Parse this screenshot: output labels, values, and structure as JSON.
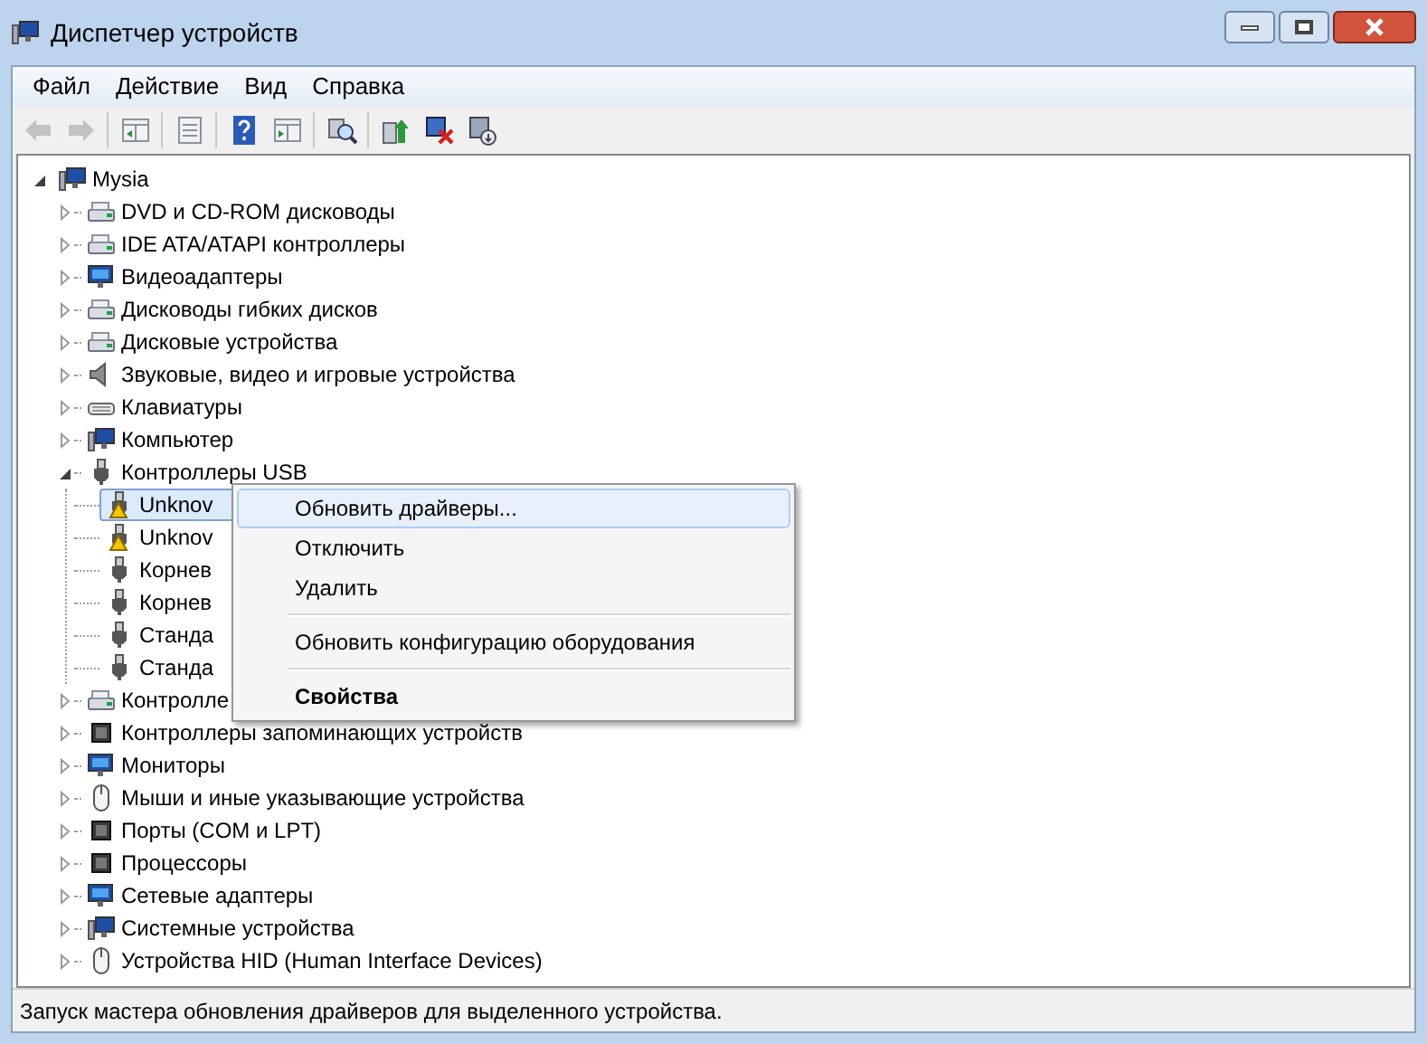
{
  "window": {
    "title": "Диспетчер устройств"
  },
  "menu_bar": [
    {
      "label": "Файл"
    },
    {
      "label": "Действие"
    },
    {
      "label": "Вид"
    },
    {
      "label": "Справка"
    }
  ],
  "toolbar": [
    {
      "kind": "back",
      "disabled": true
    },
    {
      "kind": "forward",
      "disabled": true
    },
    {
      "kind": "separator"
    },
    {
      "kind": "pane",
      "disabled": false
    },
    {
      "kind": "separator"
    },
    {
      "kind": "properties",
      "disabled": false
    },
    {
      "kind": "separator"
    },
    {
      "kind": "help",
      "disabled": false
    },
    {
      "kind": "view",
      "disabled": false
    },
    {
      "kind": "separator"
    },
    {
      "kind": "scan",
      "disabled": false
    },
    {
      "kind": "separator"
    },
    {
      "kind": "update",
      "disabled": false
    },
    {
      "kind": "uninstall",
      "disabled": false
    },
    {
      "kind": "disable",
      "disabled": false
    }
  ],
  "tree": {
    "label": "Mysia",
    "expanded": true,
    "selected": false,
    "children": [
      {
        "label": "DVD и CD-ROM дисководы",
        "expanded": false,
        "selected": false
      },
      {
        "label": "IDE ATA/ATAPI контроллеры",
        "expanded": false,
        "selected": false
      },
      {
        "label": "Видеоадаптеры",
        "expanded": false,
        "selected": false
      },
      {
        "label": "Дисководы гибких дисков",
        "expanded": false,
        "selected": false
      },
      {
        "label": "Дисковые устройства",
        "expanded": false,
        "selected": false
      },
      {
        "label": "Звуковые, видео и игровые устройства",
        "expanded": false,
        "selected": false
      },
      {
        "label": "Клавиатуры",
        "expanded": false,
        "selected": false
      },
      {
        "label": "Компьютер",
        "expanded": false,
        "selected": false
      },
      {
        "label": "Контроллеры USB",
        "expanded": true,
        "selected": false,
        "children": [
          {
            "label": "Unknov",
            "selected": true,
            "warning": true
          },
          {
            "label": "Unknov",
            "selected": false,
            "warning": true
          },
          {
            "label": "Корнев",
            "selected": false,
            "warning": false
          },
          {
            "label": "Корнев",
            "selected": false,
            "warning": false
          },
          {
            "label": "Станда",
            "selected": false,
            "warning": false
          },
          {
            "label": "Станда",
            "selected": false,
            "warning": false
          }
        ]
      },
      {
        "label": "Контролле",
        "expanded": false,
        "selected": false
      },
      {
        "label": "Контроллеры запоминающих устройств",
        "expanded": false,
        "selected": false
      },
      {
        "label": "Мониторы",
        "expanded": false,
        "selected": false
      },
      {
        "label": "Мыши и иные указывающие устройства",
        "expanded": false,
        "selected": false
      },
      {
        "label": "Порты (COM и LPT)",
        "expanded": false,
        "selected": false
      },
      {
        "label": "Процессоры",
        "expanded": false,
        "selected": false
      },
      {
        "label": "Сетевые адаптеры",
        "expanded": false,
        "selected": false
      },
      {
        "label": "Системные устройства",
        "expanded": false,
        "selected": false
      },
      {
        "label": "Устройства HID (Human Interface Devices)",
        "expanded": false,
        "selected": false
      }
    ]
  },
  "context_menu": [
    {
      "label": "Обновить драйверы...",
      "highlighted": true,
      "default": false,
      "separator_before": false
    },
    {
      "label": "Отключить",
      "highlighted": false,
      "default": false,
      "separator_before": false
    },
    {
      "label": "Удалить",
      "highlighted": false,
      "default": false,
      "separator_before": false
    },
    {
      "label": "Обновить конфигурацию оборудования",
      "highlighted": false,
      "default": false,
      "separator_before": true
    },
    {
      "label": "Свойства",
      "highlighted": false,
      "default": true,
      "separator_before": true
    }
  ],
  "status_bar": "Запуск мастера обновления драйверов для выделенного устройства."
}
